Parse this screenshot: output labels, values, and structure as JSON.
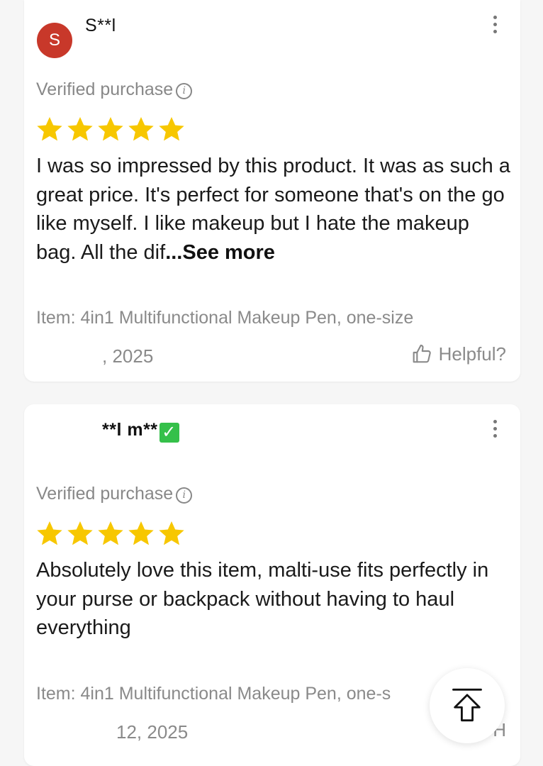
{
  "colors": {
    "star": "#f7c700",
    "avatar_bg": "#c8382a",
    "muted_text": "#8a8a8a",
    "verified_badge": "#35c04a"
  },
  "reviews": [
    {
      "avatar_letter": "S",
      "username": "S**l",
      "verified_label": "Verified purchase",
      "info_icon": "i",
      "rating": 5,
      "text": "I was so impressed by this product. It was as such a great price. It's perfect for someone that's on the go like myself. I like makeup but I hate the makeup bag. All the dif",
      "text_ellipsis": "...",
      "see_more_label": "See more",
      "item": "Item: 4in1 Multifunctional Makeup Pen, one-size",
      "date": ", 2025",
      "helpful_label": "Helpful?"
    },
    {
      "username": "**l  m**",
      "verified_badge_icon": "check-mark-button",
      "verified_label": "Verified purchase",
      "info_icon": "i",
      "rating": 5,
      "text": "Absolutely love this item, malti-use fits perfectly in your purse or backpack without having to haul everything",
      "item": "Item: 4in1 Multifunctional Makeup Pen, one-s",
      "date": "12, 2025",
      "helpful_label": "H"
    }
  ],
  "scroll_top_icon": "arrow-up-to-top-icon"
}
